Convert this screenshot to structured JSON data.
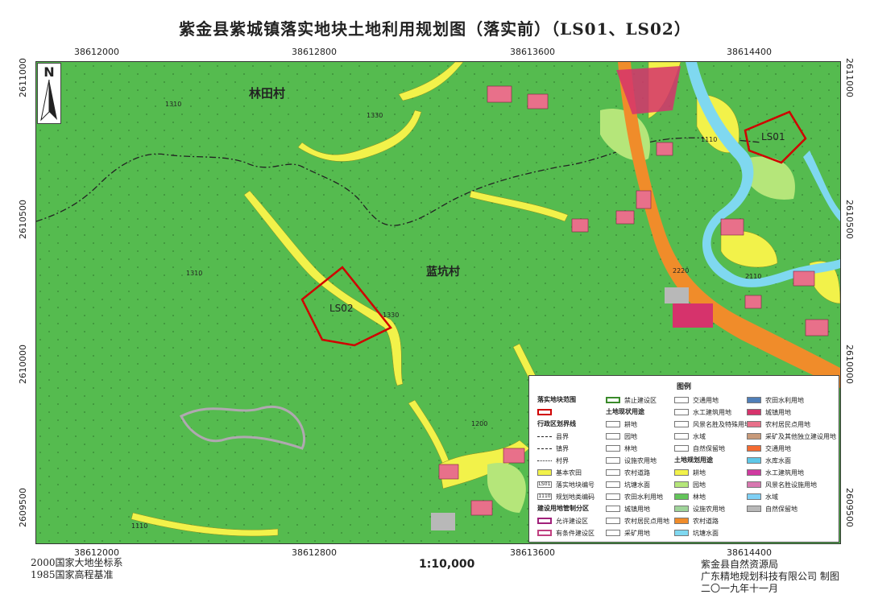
{
  "title": "紫金县紫城镇落实地块土地利用规划图（落实前）（LS01、LS02）",
  "coords": {
    "top_x": [
      "38612000",
      "38612800",
      "38613600",
      "38614400"
    ],
    "bottom_x": [
      "38612000",
      "38612800",
      "38613600",
      "38614400"
    ],
    "left_y": [
      "2611000",
      "2610500",
      "2610000",
      "2609500"
    ],
    "right_y": [
      "2611000",
      "2610500",
      "2610000",
      "2609500"
    ]
  },
  "north": "N",
  "places": {
    "lintian": "林田村",
    "lankeng": "蓝坑村"
  },
  "plots": {
    "ls01": "LS01",
    "ls02": "LS02"
  },
  "map_codes": [
    "1310",
    "1330",
    "1110",
    "1200",
    "2220",
    "1310",
    "1330",
    "1110",
    "2110"
  ],
  "scale": "1:10,000",
  "footer_left": [
    "2000国家大地坐标系",
    "1985国家高程基准"
  ],
  "footer_right": [
    "紫金县自然资源局",
    "广东精地规划科技有限公司  制图",
    "二〇一九年十一月"
  ],
  "legend": {
    "title": "图例",
    "col1": [
      {
        "label": "落实地块范围",
        "type": "hdr"
      },
      {
        "label": "",
        "color": "#ffffff",
        "border": "#d00000"
      },
      {
        "label": "行政区划界线",
        "type": "hdr"
      },
      {
        "label": "县界",
        "line": "dashdot"
      },
      {
        "label": "镇界",
        "line": "dash"
      },
      {
        "label": "村界",
        "line": "dot"
      },
      {
        "label": "基本农田",
        "color": "#f2f24a"
      },
      {
        "label": "落实地块编号",
        "box": "LS01"
      },
      {
        "label": "规划地类编码",
        "box": "1110"
      },
      {
        "label": "建设用地管制分区",
        "type": "hdr"
      },
      {
        "label": "允许建设区",
        "color": "#ffffff",
        "border": "#a0207a"
      },
      {
        "label": "有条件建设区",
        "color": "#ffffff",
        "border": "#c04080"
      }
    ],
    "col2": [
      {
        "label": "禁止建设区",
        "color": "#ffffff",
        "border": "#3a8a2a"
      },
      {
        "label": "土地现状用途",
        "type": "hdr"
      },
      {
        "label": "耕地",
        "color": "#ffffff"
      },
      {
        "label": "园地",
        "color": "#ffffff"
      },
      {
        "label": "林地",
        "color": "#ffffff"
      },
      {
        "label": "设施农用地",
        "color": "#ffffff"
      },
      {
        "label": "农村道路",
        "color": "#ffffff"
      },
      {
        "label": "坑塘水面",
        "color": "#ffffff"
      },
      {
        "label": "农田水利用地",
        "color": "#ffffff"
      },
      {
        "label": "城镇用地",
        "color": "#ffffff"
      },
      {
        "label": "农村居民点用地",
        "color": "#ffffff"
      },
      {
        "label": "采矿用地",
        "color": "#ffffff"
      }
    ],
    "col3": [
      {
        "label": "交通用地",
        "color": "#ffffff"
      },
      {
        "label": "水工建筑用地",
        "color": "#ffffff"
      },
      {
        "label": "风景名胜及特殊用地",
        "color": "#ffffff"
      },
      {
        "label": "水域",
        "color": "#ffffff"
      },
      {
        "label": "自然保留地",
        "color": "#ffffff"
      },
      {
        "label": "土地规划用途",
        "type": "hdr"
      },
      {
        "label": "耕地",
        "color": "#f2f24a"
      },
      {
        "label": "园地",
        "color": "#b5e67a"
      },
      {
        "label": "林地",
        "color": "#63c45a"
      },
      {
        "label": "设施农用地",
        "color": "#9fd49a"
      },
      {
        "label": "农村道路",
        "color": "#f08c2a"
      },
      {
        "label": "坑塘水面",
        "color": "#7fd8f0"
      }
    ],
    "col4": [
      {
        "label": "农田水利用地",
        "color": "#4f7fb8"
      },
      {
        "label": "城镇用地",
        "color": "#d6336c"
      },
      {
        "label": "农村居民点用地",
        "color": "#e8708a"
      },
      {
        "label": "采矿及其他独立建设用地",
        "color": "#c89a7a"
      },
      {
        "label": "交通用地",
        "color": "#f46b32"
      },
      {
        "label": "水库水面",
        "color": "#5ec8e8"
      },
      {
        "label": "水工建筑用地",
        "color": "#d03aa0"
      },
      {
        "label": "风景名胜设施用地",
        "color": "#d878b0"
      },
      {
        "label": "水域",
        "color": "#7fd0f5"
      },
      {
        "label": "自然保留地",
        "color": "#b8b8b8"
      }
    ]
  }
}
